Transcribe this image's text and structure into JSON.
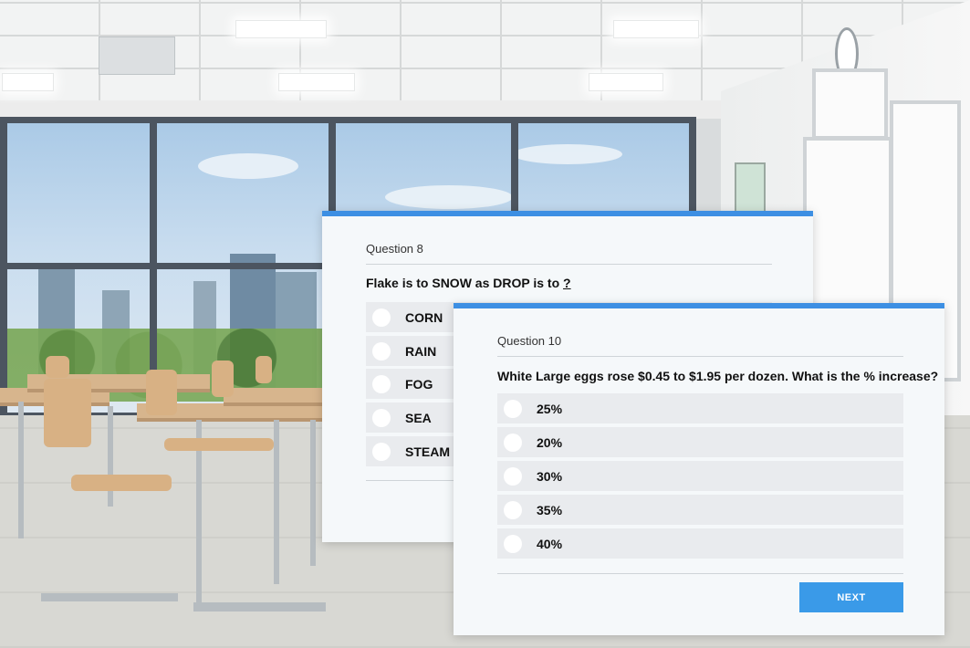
{
  "quiz_back": {
    "question_label": "Question 8",
    "question_prefix": "Flake is to SNOW as DROP is to ",
    "question_blank": "?",
    "options": [
      "CORN",
      "RAIN",
      "FOG",
      "SEA",
      "STEAM"
    ]
  },
  "quiz_front": {
    "question_label": "Question 10",
    "question_text": "White Large eggs rose $0.45 to $1.95 per dozen. What is the % increase?",
    "options": [
      "25%",
      "20%",
      "30%",
      "35%",
      "40%"
    ],
    "next_label": "NEXT"
  },
  "colors": {
    "accent": "#3d8fe3",
    "button": "#3a9ae8",
    "option_bg": "#e9ebee",
    "card_bg": "#f5f8fa"
  }
}
